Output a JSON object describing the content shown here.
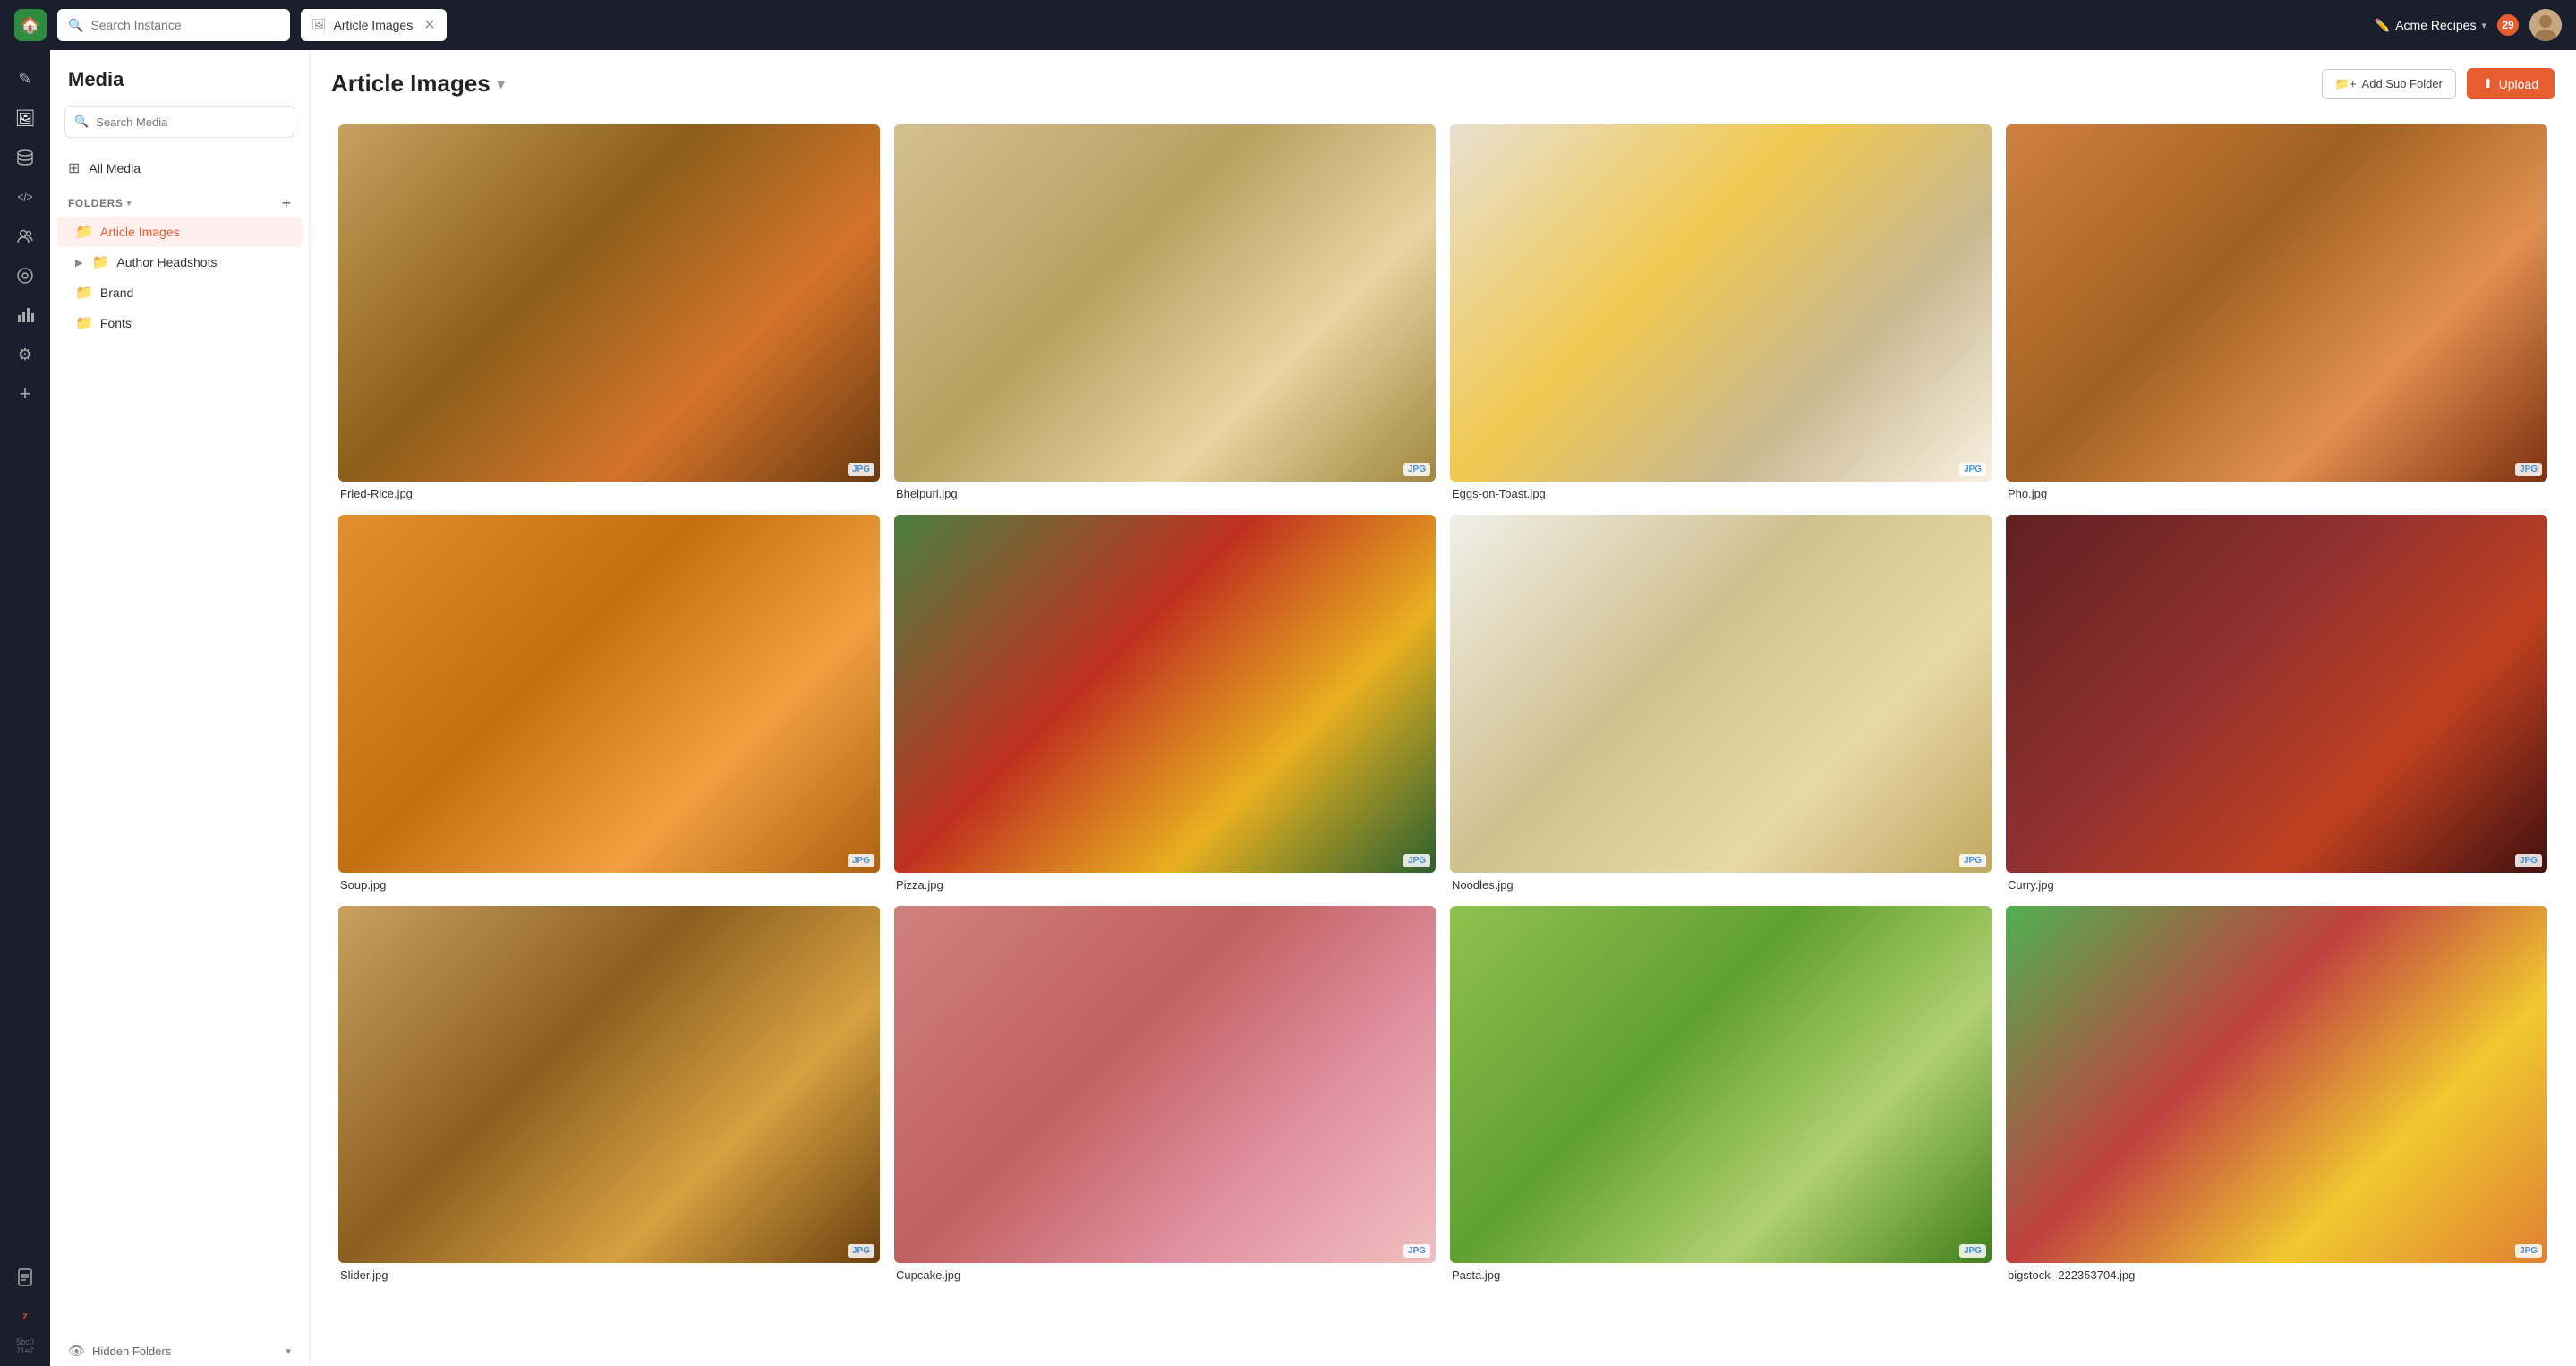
{
  "topbar": {
    "logo_text": "🏠",
    "search_instance_placeholder": "Search Instance",
    "active_tab_icon": "🖼",
    "active_tab_label": "Article Images",
    "instance_name": "Acme Recipes",
    "notifications": "29",
    "edit_icon": "✏️"
  },
  "left_sidebar_icons": [
    {
      "name": "edit-icon",
      "symbol": "✎",
      "active": false
    },
    {
      "name": "media-icon",
      "symbol": "🖼",
      "active": true
    },
    {
      "name": "database-icon",
      "symbol": "🗄",
      "active": false
    },
    {
      "name": "code-icon",
      "symbol": "</>",
      "active": false
    },
    {
      "name": "contacts-icon",
      "symbol": "👥",
      "active": false
    },
    {
      "name": "settings-circle-icon",
      "symbol": "⊙",
      "active": false
    },
    {
      "name": "chart-icon",
      "symbol": "📈",
      "active": false
    },
    {
      "name": "gear-icon",
      "symbol": "⚙",
      "active": false
    },
    {
      "name": "add-icon",
      "symbol": "+",
      "active": false
    }
  ],
  "left_panel": {
    "title": "Media",
    "search_placeholder": "Search Media",
    "all_media_label": "All Media",
    "folders_label": "FOLDERS",
    "folders": [
      {
        "name": "article-images-folder",
        "label": "Article Images",
        "active": true,
        "has_children": false,
        "color": "red"
      },
      {
        "name": "author-headshots-folder",
        "label": "Author Headshots",
        "active": false,
        "has_children": true,
        "color": "gray"
      },
      {
        "name": "brand-folder",
        "label": "Brand",
        "active": false,
        "has_children": false,
        "color": "gray"
      },
      {
        "name": "fonts-folder",
        "label": "Fonts",
        "active": false,
        "has_children": false,
        "color": "gray"
      }
    ],
    "hidden_folders_label": "Hidden Folders"
  },
  "content": {
    "title": "Article Images",
    "add_subfolder_label": "Add Sub Folder",
    "upload_label": "Upload",
    "media_items": [
      {
        "id": "fried-rice",
        "filename": "Fried-Rice.jpg",
        "badge": "JPG",
        "css_class": "food-fried-rice"
      },
      {
        "id": "bhelpuri",
        "filename": "Bhelpuri.jpg",
        "badge": "JPG",
        "css_class": "food-bhelpuri"
      },
      {
        "id": "eggs-toast",
        "filename": "Eggs-on-Toast.jpg",
        "badge": "JPG",
        "css_class": "food-eggs-toast"
      },
      {
        "id": "pho",
        "filename": "Pho.jpg",
        "badge": "JPG",
        "css_class": "food-pho"
      },
      {
        "id": "soup",
        "filename": "Soup.jpg",
        "badge": "JPG",
        "css_class": "food-soup"
      },
      {
        "id": "pizza",
        "filename": "Pizza.jpg",
        "badge": "JPG",
        "css_class": "food-pizza"
      },
      {
        "id": "noodles",
        "filename": "Noodles.jpg",
        "badge": "JPG",
        "css_class": "food-noodles"
      },
      {
        "id": "curry",
        "filename": "Curry.jpg",
        "badge": "JPG",
        "css_class": "food-curry"
      },
      {
        "id": "slider",
        "filename": "Slider.jpg",
        "badge": "JPG",
        "css_class": "food-slider"
      },
      {
        "id": "cupcake",
        "filename": "Cupcake.jpg",
        "badge": "JPG",
        "css_class": "food-cupcake"
      },
      {
        "id": "pasta",
        "filename": "Pasta.jpg",
        "badge": "JPG",
        "css_class": "food-pasta"
      },
      {
        "id": "bigstock",
        "filename": "bigstock--222353704.jpg",
        "badge": "JPG",
        "css_class": "food-bigstock"
      }
    ]
  },
  "colors": {
    "accent": "#e85d2f",
    "sidebar_bg": "#1a1f2e",
    "active_folder_bg": "#fff0ed"
  }
}
